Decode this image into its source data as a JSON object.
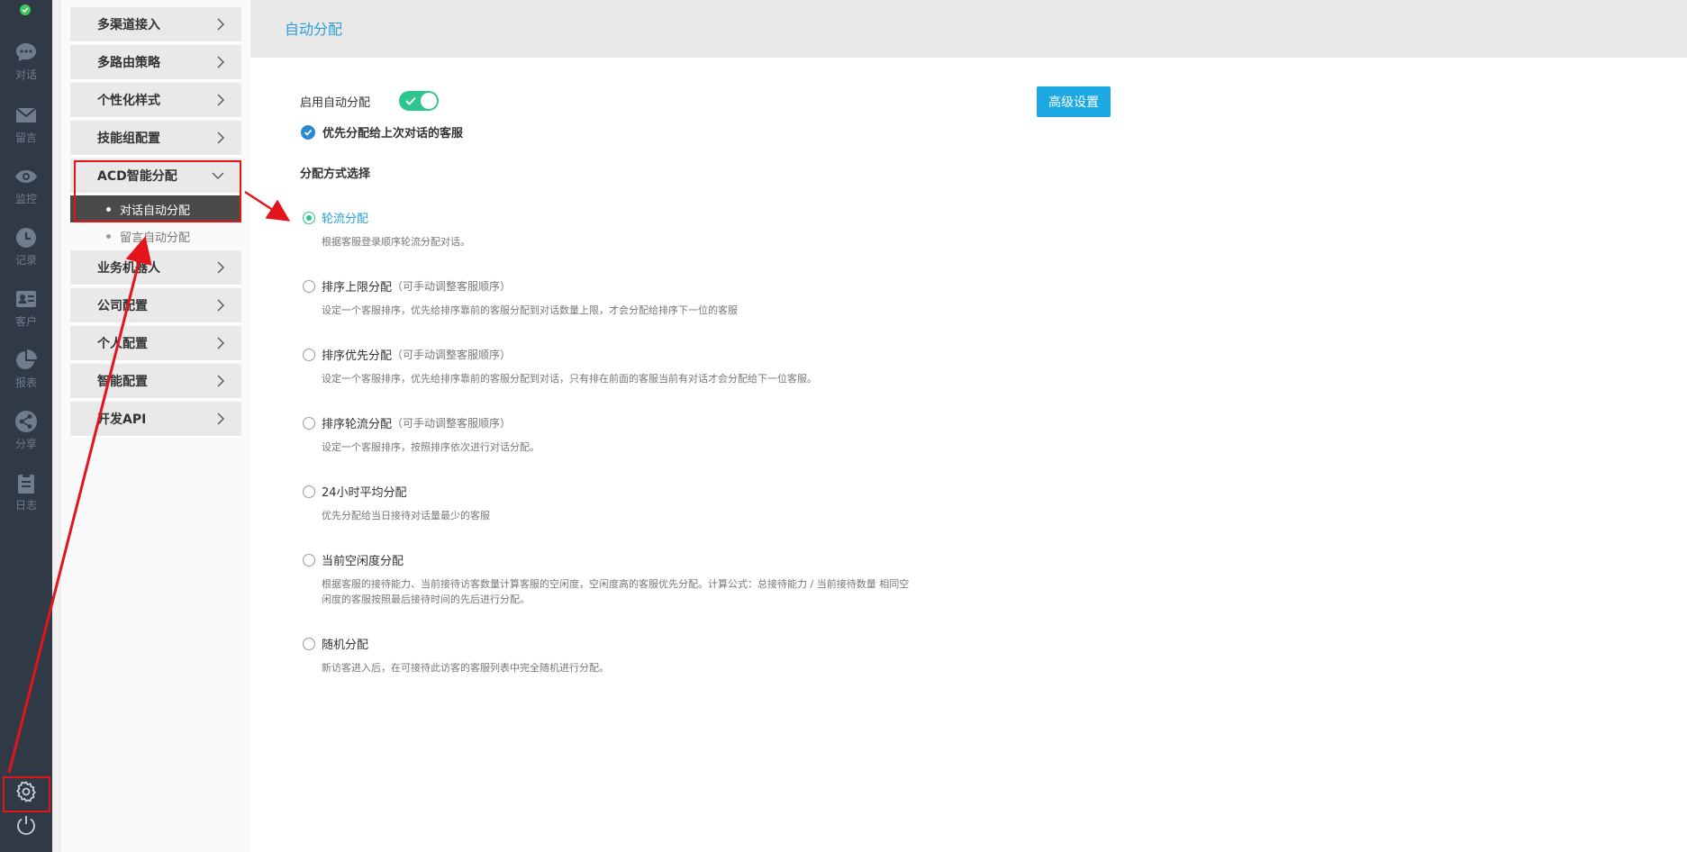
{
  "rail": {
    "items": [
      {
        "label": "对话",
        "icon": "chat-icon"
      },
      {
        "label": "留言",
        "icon": "mail-icon"
      },
      {
        "label": "监控",
        "icon": "eye-icon"
      },
      {
        "label": "记录",
        "icon": "clock-icon"
      },
      {
        "label": "客户",
        "icon": "contact-card-icon"
      },
      {
        "label": "报表",
        "icon": "pie-chart-icon"
      },
      {
        "label": "分享",
        "icon": "share-icon"
      },
      {
        "label": "日志",
        "icon": "clipboard-icon"
      }
    ],
    "bottom": [
      {
        "icon": "gear-icon"
      },
      {
        "icon": "power-icon"
      }
    ]
  },
  "menu": {
    "items": [
      {
        "label": "多渠道接入"
      },
      {
        "label": "多路由策略"
      },
      {
        "label": "个性化样式"
      },
      {
        "label": "技能组配置"
      },
      {
        "label": "ACD智能分配",
        "expanded": true
      },
      {
        "label": "业务机器人"
      },
      {
        "label": "公司配置"
      },
      {
        "label": "个人配置"
      },
      {
        "label": "智能配置"
      },
      {
        "label": "开发API"
      }
    ],
    "sub_items": [
      {
        "label": "对话自动分配",
        "active": true
      },
      {
        "label": "留言自动分配",
        "active": false
      }
    ]
  },
  "page": {
    "title": "自动分配",
    "toggle_label": "启用自动分配",
    "toggle_on": true,
    "priority_label": "优先分配给上次对话的客服",
    "priority_checked": true,
    "advanced_button": "高级设置",
    "section_title": "分配方式选择"
  },
  "options": [
    {
      "title": "轮流分配",
      "hint": "",
      "desc": "根据客服登录顺序轮流分配对话。",
      "selected": true
    },
    {
      "title": "排序上限分配",
      "hint": "（可手动调整客服顺序）",
      "desc": "设定一个客服排序，优先给排序靠前的客服分配到对话数量上限，才会分配给排序下一位的客服",
      "selected": false
    },
    {
      "title": "排序优先分配",
      "hint": "（可手动调整客服顺序）",
      "desc": "设定一个客服排序，优先给排序靠前的客服分配到对话，只有排在前面的客服当前有对话才会分配给下一位客服。",
      "selected": false
    },
    {
      "title": "排序轮流分配",
      "hint": "（可手动调整客服顺序）",
      "desc": "设定一个客服排序，按照排序依次进行对话分配。",
      "selected": false
    },
    {
      "title": "24小时平均分配",
      "hint": "",
      "desc": "优先分配给当日接待对话量最少的客服",
      "selected": false
    },
    {
      "title": "当前空闲度分配",
      "hint": "",
      "desc": "根据客服的接待能力、当前接待访客数量计算客服的空闲度，空闲度高的客服优先分配。计算公式：总接待能力 / 当前接待数量 相同空闲度的客服按照最后接待时间的先后进行分配。",
      "selected": false
    },
    {
      "title": "随机分配",
      "hint": "",
      "desc": "新访客进入后，在可接待此访客的客服列表中完全随机进行分配。",
      "selected": false
    }
  ],
  "colors": {
    "rail_bg": "#2f3a46",
    "accent_blue": "#2a9fd6",
    "toggle_green": "#2dc58e",
    "button_blue": "#1ba8e3",
    "annotation_red": "#e4141b"
  }
}
